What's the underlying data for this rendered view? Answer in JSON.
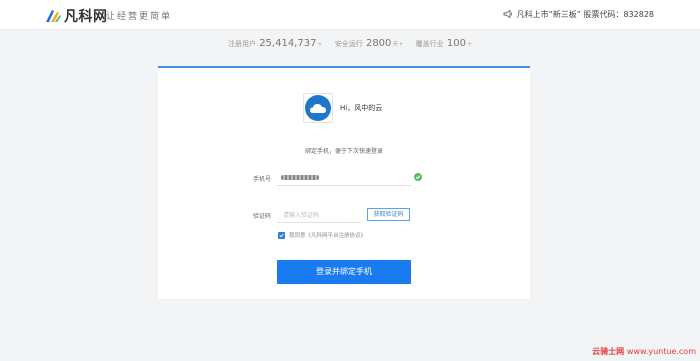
{
  "header": {
    "logo_text": "凡科网",
    "slogan": "让经营更简单",
    "notice": "凡科上市“新三板” 股票代码：832828"
  },
  "stats": [
    {
      "label": "注册用户",
      "value": "25,414,737",
      "suffix": "+"
    },
    {
      "label": "安全运行",
      "value": "2800",
      "suffix": "天+"
    },
    {
      "label": "覆盖行业",
      "value": "100",
      "suffix": "+"
    }
  ],
  "card": {
    "greeting": "Hi，风中的云",
    "subtitle": "绑定手机，便于下次快速登录",
    "phone_label": "手机号",
    "code_label": "验证码",
    "code_placeholder": "请输入验证码",
    "get_code_label": "获取验证码",
    "agree_text": "我同意《凡科网平台注册协议》",
    "agree_checked": true,
    "submit_label": "登录并绑定手机"
  },
  "watermark": {
    "site": "云骑士网",
    "url": "www.yuntue.com"
  },
  "colors": {
    "accent": "#1a7bf0",
    "success": "#5cb85c",
    "card_top_border": "#4a90e2"
  }
}
